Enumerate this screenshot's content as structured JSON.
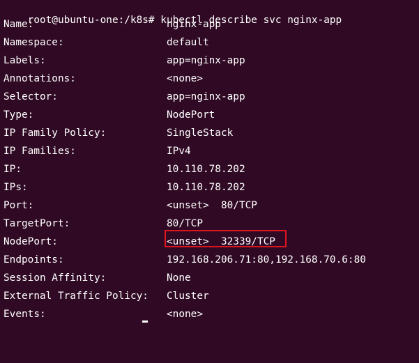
{
  "terminal": {
    "prompt": "root@ubuntu-one:/k8s#",
    "command": "kubectl describe svc nginx-app",
    "fields": [
      {
        "key": "Name:",
        "value": "nginx-app"
      },
      {
        "key": "Namespace:",
        "value": "default"
      },
      {
        "key": "Labels:",
        "value": "app=nginx-app"
      },
      {
        "key": "Annotations:",
        "value": "<none>"
      },
      {
        "key": "Selector:",
        "value": "app=nginx-app"
      },
      {
        "key": "Type:",
        "value": "NodePort"
      },
      {
        "key": "IP Family Policy:",
        "value": "SingleStack"
      },
      {
        "key": "IP Families:",
        "value": "IPv4"
      },
      {
        "key": "IP:",
        "value": "10.110.78.202"
      },
      {
        "key": "IPs:",
        "value": "10.110.78.202"
      },
      {
        "key": "Port:",
        "value": "<unset>  80/TCP"
      },
      {
        "key": "TargetPort:",
        "value": "80/TCP"
      },
      {
        "key": "NodePort:",
        "value": "<unset>  32339/TCP"
      },
      {
        "key": "Endpoints:",
        "value": "192.168.206.71:80,192.168.70.6:80"
      },
      {
        "key": "Session Affinity:",
        "value": "None"
      },
      {
        "key": "External Traffic Policy:",
        "value": "Cluster"
      },
      {
        "key": "Events:",
        "value": "<none>"
      }
    ]
  },
  "colors": {
    "background": "#300a24",
    "text": "#ffffff",
    "highlight_border": "#e0141e"
  }
}
